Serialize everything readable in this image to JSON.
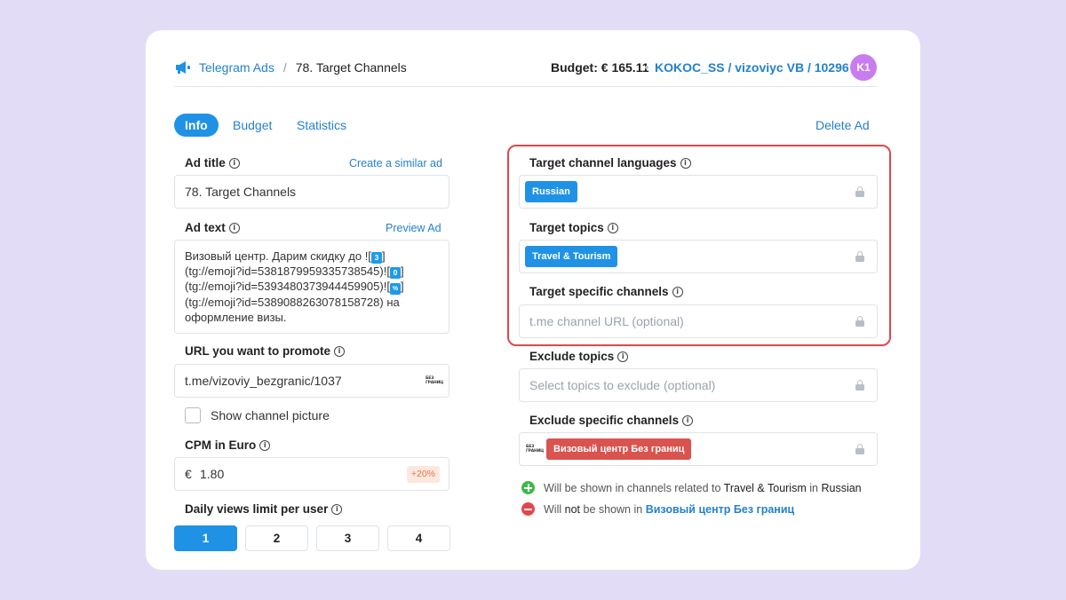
{
  "header": {
    "app_name": "Telegram Ads",
    "separator": "/",
    "page_title": "78. Target Channels",
    "budget": "Budget: € 165.11",
    "account": "KOKOC_SS / vizoviyc VB / 10296",
    "avatar_initials": "K1"
  },
  "tabs": [
    {
      "label": "Info",
      "active": true
    },
    {
      "label": "Budget",
      "active": false
    },
    {
      "label": "Statistics",
      "active": false
    }
  ],
  "delete_label": "Delete Ad",
  "left": {
    "ad_title": {
      "label": "Ad title",
      "action": "Create a similar ad",
      "value": "78. Target Channels"
    },
    "ad_text": {
      "label": "Ad text",
      "action": "Preview Ad",
      "lines": [
        "Визовый центр. Дарим скидку до ![",
        "(tg://emoji?id=5381879959335738545)![",
        "(tg://emoji?id=5393480373944459905)![",
        "(tg://emoji?id=5389088263078158728) на",
        "оформление визы."
      ],
      "emoji": [
        "3",
        "0",
        "%"
      ],
      "bracket_close": "]"
    },
    "url": {
      "label": "URL you want to promote",
      "value": "t.me/vizoviy_bezgranic/1037",
      "logo_text": "БЕЗ ГРАНИЦ"
    },
    "show_picture": {
      "label": "Show channel picture",
      "checked": false
    },
    "cpm": {
      "label": "CPM in Euro",
      "currency": "€",
      "value": "1.80",
      "badge": "+20%"
    },
    "daily_views": {
      "label": "Daily views limit per user",
      "options": [
        "1",
        "2",
        "3",
        "4"
      ],
      "selected": "1"
    }
  },
  "right": {
    "languages": {
      "label": "Target channel languages",
      "chips": [
        "Russian"
      ]
    },
    "topics": {
      "label": "Target topics",
      "chips": [
        "Travel & Tourism"
      ]
    },
    "specific_channels": {
      "label": "Target specific channels",
      "placeholder": "t.me channel URL (optional)"
    },
    "exclude_topics": {
      "label": "Exclude topics",
      "placeholder": "Select topics to exclude (optional)"
    },
    "exclude_channels": {
      "label": "Exclude specific channels",
      "chip": "Визовый центр Без границ",
      "logo_text": "БЕЗ ГРАНИЦ"
    },
    "summary": {
      "shown_prefix": "Will be shown in channels related to",
      "shown_topic": "Travel & Tourism",
      "shown_in": "in",
      "shown_language": "Russian",
      "not_shown_prefix": "Will",
      "not_shown_not": "not",
      "not_shown_middle": "be shown in",
      "not_shown_channel": "Визовый центр Без границ"
    }
  },
  "colors": {
    "accent": "#2092e6",
    "link": "#2481cc",
    "highlight_border": "#e0474c",
    "positive": "#3cb94a",
    "negative": "#e0474c",
    "avatar": "#c97cf0"
  }
}
